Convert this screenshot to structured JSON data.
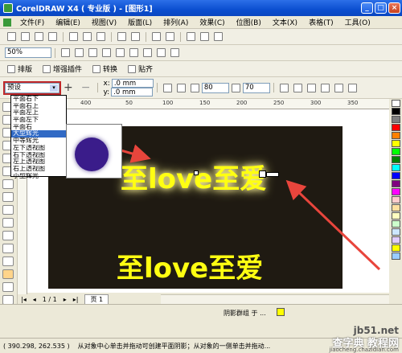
{
  "window": {
    "title": "CorelDRAW X4 ( 专业版 ) - [图形1]",
    "min": "_",
    "max": "□",
    "close": "×"
  },
  "menu": [
    "文件(F)",
    "编辑(E)",
    "视图(V)",
    "版面(L)",
    "排列(A)",
    "效果(C)",
    "位图(B)",
    "文本(X)",
    "表格(T)",
    "工具(O)"
  ],
  "zoom": {
    "value": "50%"
  },
  "plugin_bar": {
    "items": [
      "排版",
      "增强插件",
      "转换",
      "贴齐"
    ]
  },
  "property_bar": {
    "preset": "预设",
    "x_label": "x:",
    "x_value": ".0 mm",
    "y_label": "y:",
    "y_value": ".0 mm",
    "opacity": "80",
    "feather": "70",
    "plus": "+",
    "minus": "−"
  },
  "preset_options": [
    "平面右下",
    "平面右上",
    "平面左上",
    "平面左下",
    "平面右",
    "大型辉光",
    "中等辉光",
    "左下透视图",
    "右下透视图",
    "左上透视图",
    "右上透视图",
    "小型辉光"
  ],
  "preset_selected_index": 5,
  "ruler_ticks": [
    "400",
    "50",
    "100",
    "150",
    "200",
    "250",
    "300",
    "350"
  ],
  "canvas": {
    "text_glow": "至love至爱",
    "text_plain": "至love至爱"
  },
  "page_nav": {
    "current": "1 / 1",
    "tab": "页 1"
  },
  "status": {
    "selection": "阴影群组 于 ...",
    "coords": "( 390.298, 262.535 )",
    "hint": "从对象中心单击并拖动可创建平面阴影；从对象的一侧单击并拖动..."
  },
  "palette_colors": [
    "#ffffff",
    "#000000",
    "#7f7f7f",
    "#ff0000",
    "#ff8000",
    "#ffff00",
    "#00ff00",
    "#008000",
    "#00ffff",
    "#0000ff",
    "#800080",
    "#ff00ff",
    "#ffcccc",
    "#ffe0a0",
    "#ffffc0",
    "#ccffcc",
    "#cce6ff",
    "#e0ccff",
    "#ffff00",
    "#99ccff"
  ],
  "watermark": {
    "line1": "jb51.net",
    "line2": "查字典 教程网",
    "line3": "jiaocheng.chazidian.com"
  }
}
